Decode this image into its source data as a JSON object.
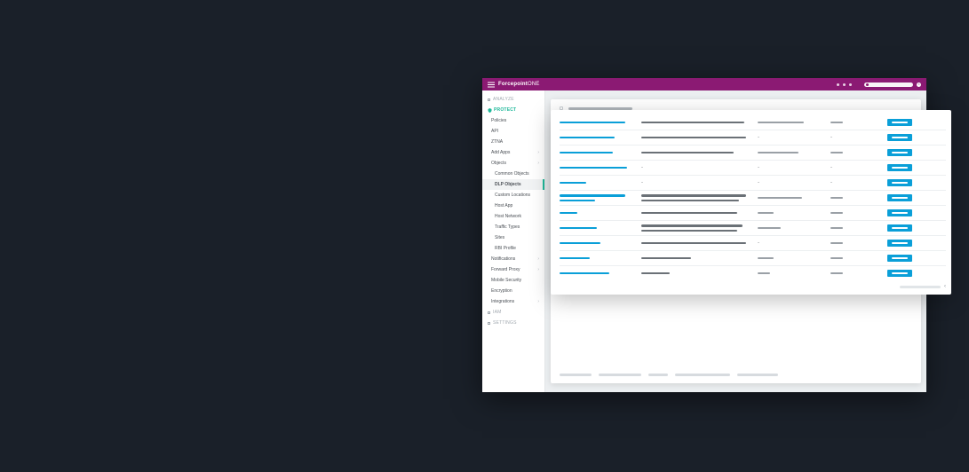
{
  "brand": {
    "bold": "Forcepoint",
    "light": "ONE"
  },
  "topbar": {
    "menu_icon": "hamburger-icon"
  },
  "sidebar": {
    "analyze_label": "ANALYZE",
    "protect_label": "PROTECT",
    "iam_label": "IAM",
    "settings_label": "SETTINGS",
    "items": [
      {
        "label": "Policies",
        "expandable": false
      },
      {
        "label": "API",
        "expandable": false
      },
      {
        "label": "ZTNA",
        "expandable": false
      },
      {
        "label": "Add Apps",
        "expandable": true
      },
      {
        "label": "Objects",
        "expandable": true
      }
    ],
    "objects_children": [
      {
        "label": "Common Objects"
      },
      {
        "label": "DLP Objects",
        "active": true
      },
      {
        "label": "Custom Locations"
      },
      {
        "label": "Host App"
      },
      {
        "label": "Host Network"
      },
      {
        "label": "Traffic Types"
      },
      {
        "label": "Sites"
      },
      {
        "label": "RBI Profile"
      }
    ],
    "items2": [
      {
        "label": "Notifications",
        "expandable": true
      },
      {
        "label": "Forward Proxy",
        "expandable": true
      },
      {
        "label": "Mobile Security",
        "expandable": false
      },
      {
        "label": "Encryption",
        "expandable": false
      },
      {
        "label": "Integrations",
        "expandable": true
      }
    ]
  },
  "table": {
    "rows": [
      {
        "name_w": 74,
        "name2_w": 0,
        "desc_w": 116,
        "desc2_w": 0,
        "a": "line",
        "a_w": 52,
        "b": "line",
        "b_w": 14
      },
      {
        "name_w": 62,
        "name2_w": 0,
        "desc_w": 118,
        "desc2_w": 0,
        "a": "dash",
        "b": "dash"
      },
      {
        "name_w": 60,
        "name2_w": 0,
        "desc_w": 104,
        "desc2_w": 0,
        "a": "line",
        "a_w": 46,
        "b": "line",
        "b_w": 14
      },
      {
        "name_w": 76,
        "name2_w": 0,
        "desc_w": 0,
        "desc2_w": 0,
        "a": "dash",
        "desc_dash": true,
        "b": "dash"
      },
      {
        "name_w": 30,
        "name2_w": 0,
        "desc_w": 0,
        "desc2_w": 0,
        "a": "dash",
        "desc_dash": true,
        "b": "dash"
      },
      {
        "name_w": 74,
        "name2_w": 40,
        "desc_w": 118,
        "desc2_w": 110,
        "a": "line",
        "a_w": 50,
        "b": "line",
        "b_w": 14
      },
      {
        "name_w": 20,
        "name2_w": 0,
        "desc_w": 108,
        "desc2_w": 0,
        "a": "line",
        "a_w": 18,
        "b": "line",
        "b_w": 14
      },
      {
        "name_w": 42,
        "name2_w": 0,
        "desc_w": 114,
        "desc2_w": 108,
        "a": "line",
        "a_w": 26,
        "b": "line",
        "b_w": 14
      },
      {
        "name_w": 46,
        "name2_w": 0,
        "desc_w": 118,
        "desc2_w": 0,
        "a": "dash",
        "b": "dash",
        "b_line_w": 14,
        "b_is_line": true
      },
      {
        "name_w": 34,
        "name2_w": 0,
        "desc_w": 56,
        "desc2_w": 0,
        "a": "line",
        "a_w": 18,
        "b": "line",
        "b_w": 14
      },
      {
        "name_w": 56,
        "name2_w": 0,
        "desc_w": 32,
        "desc2_w": 0,
        "a": "line",
        "a_w": 14,
        "b": "line",
        "b_w": 14
      }
    ]
  },
  "colors": {
    "brand_bg": "#8b1a73",
    "accent": "#1fb89a",
    "primary": "#0a9fd8"
  }
}
